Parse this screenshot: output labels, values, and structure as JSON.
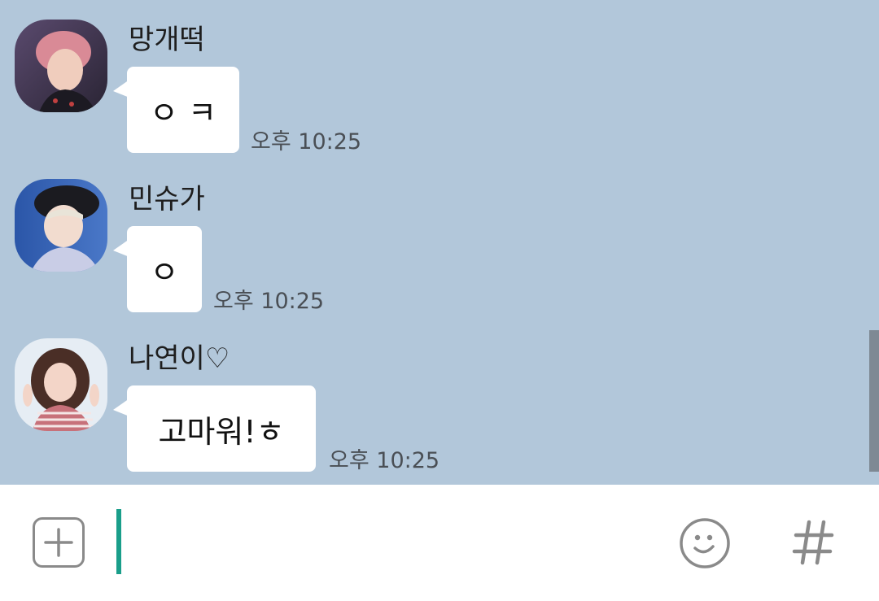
{
  "colors": {
    "chat_background": "#b2c7da",
    "bubble": "#ffffff",
    "cursor": "#1a9e8a",
    "input_bar": "#ffffff",
    "icon_gray": "#8a8a8a"
  },
  "messages": [
    {
      "sender": "망개떡",
      "text": "ㅇ ㅋ",
      "time": "오후 10:25"
    },
    {
      "sender": "민슈가",
      "text": "ㅇ",
      "time": "오후 10:25"
    },
    {
      "sender": "나연이♡",
      "text": "고마워!ㅎ",
      "time": "오후 10:25"
    }
  ],
  "input": {
    "value": "",
    "plus_icon": "plus-square-icon",
    "emoji_icon": "smiley-icon",
    "hashtag_icon": "hashtag-icon"
  }
}
